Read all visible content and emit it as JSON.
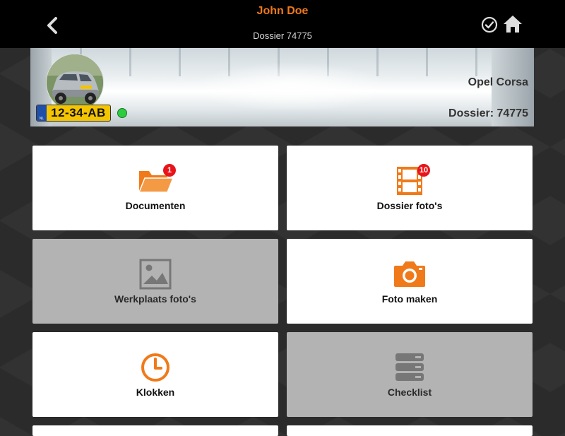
{
  "header": {
    "title": "John Doe",
    "subtitle": "Dossier 74775",
    "back_icon": "chevron-left-icon",
    "check_icon": "check-circle-icon",
    "home_icon": "home-icon"
  },
  "vehicle": {
    "plate": "12-34-AB",
    "plate_country": "NL",
    "model": "Opel Corsa",
    "dossier": "Dossier: 74775",
    "status_color": "#2ecc40"
  },
  "tiles": [
    {
      "label": "Documenten",
      "icon": "folder-open-icon",
      "badge": "1",
      "enabled": true
    },
    {
      "label": "Dossier foto's",
      "icon": "film-icon",
      "badge": "10",
      "enabled": true
    },
    {
      "label": "Werkplaats foto's",
      "icon": "image-icon",
      "enabled": false
    },
    {
      "label": "Foto maken",
      "icon": "camera-icon",
      "enabled": true
    },
    {
      "label": "Klokken",
      "icon": "clock-icon",
      "enabled": true
    },
    {
      "label": "Checklist",
      "icon": "server-icon",
      "enabled": false
    }
  ],
  "colors": {
    "accent": "#f07a1a",
    "topbar": "#000000",
    "disabled_tile": "#b3b3b3",
    "badge": "#e8141a"
  }
}
